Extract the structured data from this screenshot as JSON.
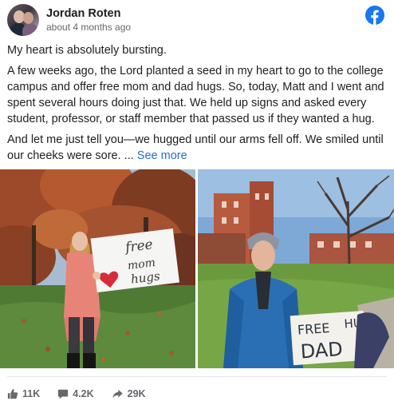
{
  "post": {
    "author": "Jordan Roten",
    "timestamp": "about 4 months ago",
    "paragraphs": [
      "My heart is absolutely bursting.",
      "A few weeks ago, the Lord planted a seed in my heart to go to the college campus and offer free mom and dad hugs. So, today, Matt and I went and spent several hours doing just that. We held up signs and asked every student, professor, or staff member that passed us if they wanted a hug.",
      "And let me just tell you—we hugged until our arms fell off. We smiled until our cheeks were sore. ..."
    ],
    "see_more": "See more"
  },
  "photos": {
    "left_sign": [
      "free",
      "mom",
      "hugs"
    ],
    "right_sign": [
      "FREE",
      "DAD",
      "HUGS"
    ]
  },
  "stats": {
    "likes": "11K",
    "comments": "4.2K",
    "shares": "29K"
  },
  "icons": {
    "brand": "facebook-logo-icon",
    "like": "thumbs-up-icon",
    "comment": "comment-bubble-icon",
    "share": "share-arrow-icon"
  },
  "colors": {
    "facebook_blue": "#1877f2",
    "link_blue": "#216fdb",
    "secondary_text": "#65676b"
  }
}
